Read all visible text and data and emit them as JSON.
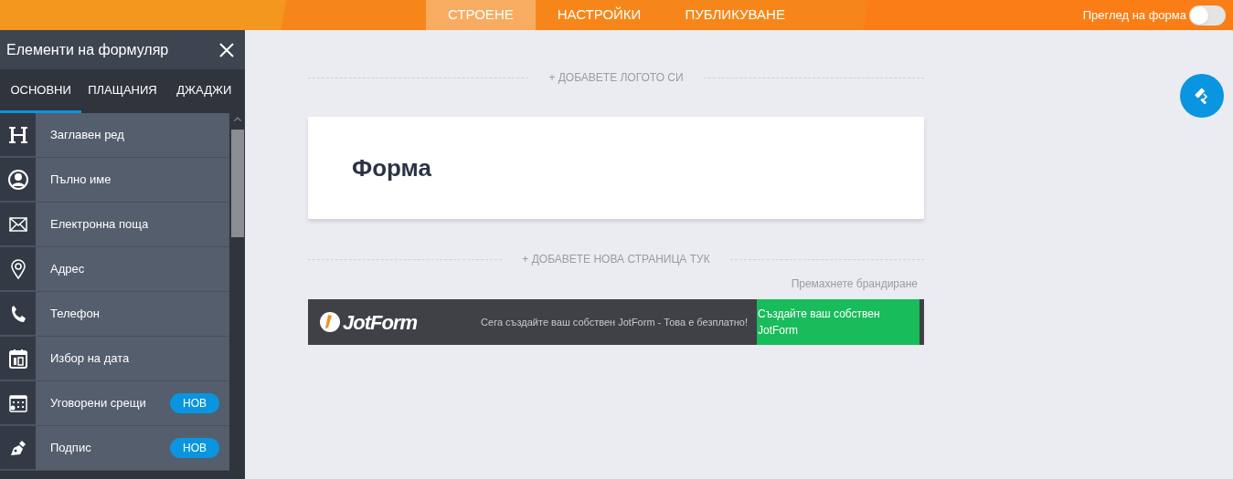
{
  "top_nav": {
    "tabs": [
      {
        "label": "СТРОЕНЕ",
        "selected": true
      },
      {
        "label": "НАСТРОЙКИ",
        "selected": false
      },
      {
        "label": "ПУБЛИКУВАНЕ",
        "selected": false
      }
    ],
    "preview": {
      "label": "Преглед на форма",
      "on": false
    }
  },
  "sidebar": {
    "title": "Елементи на формуляр",
    "tabs": [
      {
        "label": "ОСНОВНИ",
        "selected": true
      },
      {
        "label": "ПЛАЩАНИЯ",
        "selected": false
      },
      {
        "label": "ДЖАДЖИ",
        "selected": false
      }
    ],
    "items": [
      {
        "label": "Заглавен ред"
      },
      {
        "label": "Пълно име"
      },
      {
        "label": "Електронна поща"
      },
      {
        "label": "Адрес"
      },
      {
        "label": "Телефон"
      },
      {
        "label": "Избор на дата"
      },
      {
        "label": "Уговорени срещи",
        "badge": "НОВ"
      },
      {
        "label": "Подпис",
        "badge": "НОВ"
      }
    ]
  },
  "canvas": {
    "add_logo": "+ ДОБАВЕТЕ ЛОГОТО СИ",
    "form_title": "Форма",
    "add_page": "+ ДОБАВЕТЕ НОВА СТРАНИЦА ТУК",
    "remove_branding": "Премахнете брандиране",
    "banner": {
      "logo": "JotForm",
      "message": "Сега създайте ваш собствен JotForm - Това е безплатно!",
      "button": "Създайте ваш собствен JotForm"
    }
  }
}
